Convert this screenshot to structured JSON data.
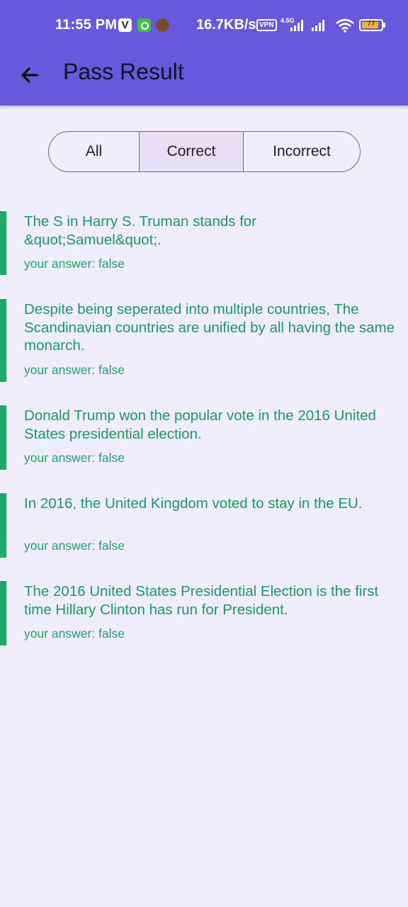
{
  "status_bar": {
    "time": "11:55 PM",
    "app_badge_v": "V",
    "net_speed": "16.7KB/s",
    "vpn": "VPN",
    "network": "4.5G",
    "battery": "77"
  },
  "app_bar": {
    "back_icon": "arrow-left-icon",
    "title": "Pass Result"
  },
  "filter": {
    "options": [
      "All",
      "Correct",
      "Incorrect"
    ],
    "selected": "Correct"
  },
  "results": [
    {
      "question": "The S in Harry S. Truman stands for &quot;Samuel&quot;.",
      "answer": "your answer: false"
    },
    {
      "question": "Despite being seperated into multiple countries, The Scandinavian countries are unified by all having the same monarch.",
      "answer": "your answer: false"
    },
    {
      "question": "Donald Trump won the popular vote in the 2016 United States presidential election.",
      "answer": "your answer: false"
    },
    {
      "question": "In 2016, the United Kingdom voted to stay in the EU.",
      "answer": "your answer: false"
    },
    {
      "question": "The 2016 United States Presidential Election is the first time Hillary Clinton has run for President.",
      "answer": "your answer: false"
    }
  ],
  "colors": {
    "primary": "#6a58dc",
    "background": "#eeedf9",
    "correct_green": "#1daa68",
    "selected_segment": "#e6dff6"
  }
}
